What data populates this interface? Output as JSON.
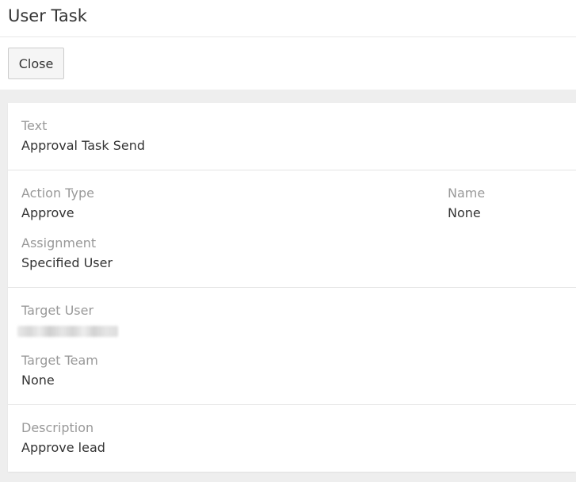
{
  "header": {
    "title": "User Task"
  },
  "toolbar": {
    "close_label": "Close"
  },
  "fields": {
    "text": {
      "label": "Text",
      "value": "Approval Task Send"
    },
    "action_type": {
      "label": "Action Type",
      "value": "Approve"
    },
    "name": {
      "label": "Name",
      "value": "None"
    },
    "assignment": {
      "label": "Assignment",
      "value": "Specified User"
    },
    "target_user": {
      "label": "Target User"
    },
    "target_team": {
      "label": "Target Team",
      "value": "None"
    },
    "description": {
      "label": "Description",
      "value": "Approve lead"
    }
  },
  "colors": {
    "label": "#999999",
    "value": "#333333",
    "background_area": "#eeeeee",
    "panel": "#ffffff"
  }
}
